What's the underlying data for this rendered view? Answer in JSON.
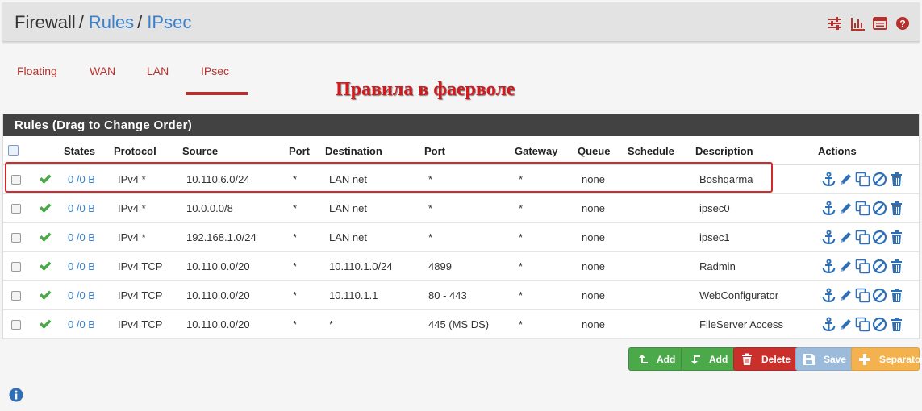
{
  "breadcrumb": {
    "root": "Firewall",
    "rules": "Rules",
    "current": "IPsec"
  },
  "header_icons": [
    "sliders-icon",
    "bar-chart-icon",
    "list-icon",
    "help-icon"
  ],
  "tabs": [
    {
      "label": "Floating",
      "active": false
    },
    {
      "label": "WAN",
      "active": false
    },
    {
      "label": "LAN",
      "active": false
    },
    {
      "label": "IPsec",
      "active": true
    }
  ],
  "annotation": "Правила в фаерволе",
  "panel": {
    "title": "Rules (Drag to Change Order)",
    "columns": [
      "States",
      "Protocol",
      "Source",
      "Port",
      "Destination",
      "Port",
      "Gateway",
      "Queue",
      "Schedule",
      "Description",
      "Actions"
    ]
  },
  "rules": [
    {
      "states": "0 /0 B",
      "protocol": "IPv4 *",
      "source": "10.110.6.0/24",
      "sport": "*",
      "destination": "LAN net",
      "dport": "*",
      "gateway": "*",
      "queue": "none",
      "schedule": "",
      "description": "Boshqarma"
    },
    {
      "states": "0 /0 B",
      "protocol": "IPv4 *",
      "source": "10.0.0.0/8",
      "sport": "*",
      "destination": "LAN net",
      "dport": "*",
      "gateway": "*",
      "queue": "none",
      "schedule": "",
      "description": "ipsec0"
    },
    {
      "states": "0 /0 B",
      "protocol": "IPv4 *",
      "source": "192.168.1.0/24",
      "sport": "*",
      "destination": "LAN net",
      "dport": "*",
      "gateway": "*",
      "queue": "none",
      "schedule": "",
      "description": "ipsec1"
    },
    {
      "states": "0 /0 B",
      "protocol": "IPv4 TCP",
      "source": "10.110.0.0/20",
      "sport": "*",
      "destination": "10.110.1.0/24",
      "dport": "4899",
      "gateway": "*",
      "queue": "none",
      "schedule": "",
      "description": "Radmin"
    },
    {
      "states": "0 /0 B",
      "protocol": "IPv4 TCP",
      "source": "10.110.0.0/20",
      "sport": "*",
      "destination": "10.110.1.1",
      "dport": "80 - 443",
      "gateway": "*",
      "queue": "none",
      "schedule": "",
      "description": "WebConfigurator"
    },
    {
      "states": "0 /0 B",
      "protocol": "IPv4 TCP",
      "source": "10.110.0.0/20",
      "sport": "*",
      "destination": "*",
      "dport": "445 (MS DS)",
      "gateway": "*",
      "queue": "none",
      "schedule": "",
      "description": "FileServer Access"
    }
  ],
  "buttons": {
    "add_top": "Add",
    "add_bottom": "Add",
    "delete": "Delete",
    "save": "Save",
    "separator": "Separator"
  },
  "colors": {
    "link": "#3b80c8",
    "tab_active": "#b5312d",
    "panel_heading": "#424242",
    "enabled_check": "#4ca94a",
    "highlight": "#d22a2a"
  }
}
